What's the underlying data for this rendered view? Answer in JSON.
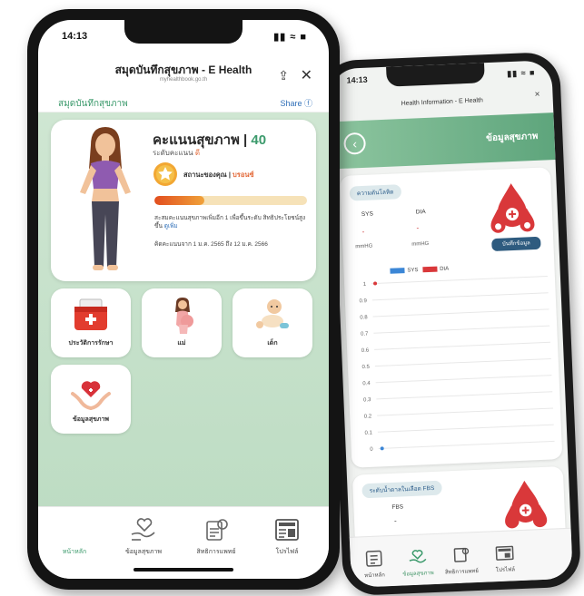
{
  "colors": {
    "green_accent": "#3c9a6c",
    "green_background": "#c6e2cb",
    "orange_highlight": "#e36a3a",
    "blue_link": "#2f6fb8",
    "button_navy": "#2e5b7f",
    "sys_blue": "#3b86d6",
    "dia_red": "#d9383a"
  },
  "front_phone": {
    "status": {
      "time": "14:13",
      "icons": "▮▮ ≈ ■"
    },
    "header": {
      "title": "สมุดบันทึกสุขภาพ - E Health",
      "subtitle": "myhealthbook.go.th",
      "share_icon": "share-icon",
      "close_icon": "close-icon"
    },
    "subnav": {
      "title": "สมุดบันทึกสุขภาพ",
      "share": "Share ⓕ"
    },
    "profile": {
      "score_label": "คะแนนสุขภาพ",
      "score_separator": " | ",
      "score_value": "40",
      "level_prefix": "ระดับคะแนน ",
      "level_value": "ดี",
      "status_prefix": "สถานะของคุณ | ",
      "status_value": "บรอนซ์",
      "progress_percent": 33,
      "description": "สะสมคะแนนสุขภาพเพิ่มอีก 1 เพื่อขึ้นระดับ สิทธิประโยชน์สูงขึ้น",
      "description_link": "ดูเพิ่ม",
      "date_range": "คิดคะแนนจาก 1 ม.ค. 2565 ถึง 12 ม.ค. 2566"
    },
    "tiles": [
      {
        "label": "ประวัติการรักษา",
        "icon": "medical-kit-icon"
      },
      {
        "label": "แม่",
        "icon": "pregnant-mother-icon"
      },
      {
        "label": "เด็ก",
        "icon": "baby-icon"
      },
      {
        "label": "ข้อมูลสุขภาพ",
        "icon": "heart-in-hands-icon"
      }
    ],
    "tabbar": [
      {
        "label": "หน้าหลัก",
        "icon": "home-icon",
        "active": true
      },
      {
        "label": "ข้อมูลสุขภาพ",
        "icon": "health-hand-icon"
      },
      {
        "label": "สิทธิการแพทย์",
        "icon": "medical-rights-icon"
      },
      {
        "label": "โปรไฟล์",
        "icon": "profile-card-icon"
      }
    ]
  },
  "back_phone": {
    "status": {
      "time": "14:13",
      "icons": "▮▮ ≈ ■"
    },
    "title": "Health Information - E Health",
    "close": "×",
    "header": {
      "back_icon": "back-arrow-icon",
      "label": "ข้อมูลสุขภาพ"
    },
    "bp_card": {
      "pill": "ความดันโลหิต",
      "sys_label": "SYS",
      "dia_label": "DIA",
      "sys_value": "-",
      "dia_value": "-",
      "sys_unit": "mmHG",
      "dia_unit": "mmHG",
      "button": "บันทึกข้อมูล"
    },
    "glucose_card": {
      "pill": "ระดับน้ำตาลในเลือด FBS",
      "label": "FBS",
      "value": "-"
    },
    "tabbar": [
      {
        "label": "หน้าหลัก",
        "icon": "home-icon"
      },
      {
        "label": "ข้อมูลสุขภาพ",
        "icon": "health-hand-icon",
        "active": true
      },
      {
        "label": "สิทธิการแพทย์",
        "icon": "medical-rights-icon"
      },
      {
        "label": "โปรไฟล์",
        "icon": "profile-card-icon"
      }
    ]
  },
  "chart_data": {
    "type": "line",
    "legend": [
      "SYS",
      "DIA"
    ],
    "series": [
      {
        "name": "SYS",
        "color": "#3b86d6",
        "values": [
          0,
          0
        ]
      },
      {
        "name": "DIA",
        "color": "#d9383a",
        "values": [
          1,
          0
        ]
      }
    ],
    "y_ticks": [
      "0",
      "0.1",
      "0.2",
      "0.3",
      "0.4",
      "0.5",
      "0.6",
      "0.7",
      "0.8",
      "0.9",
      "1"
    ],
    "ylim": [
      0,
      1
    ],
    "grid": true,
    "legend_position": "top"
  }
}
